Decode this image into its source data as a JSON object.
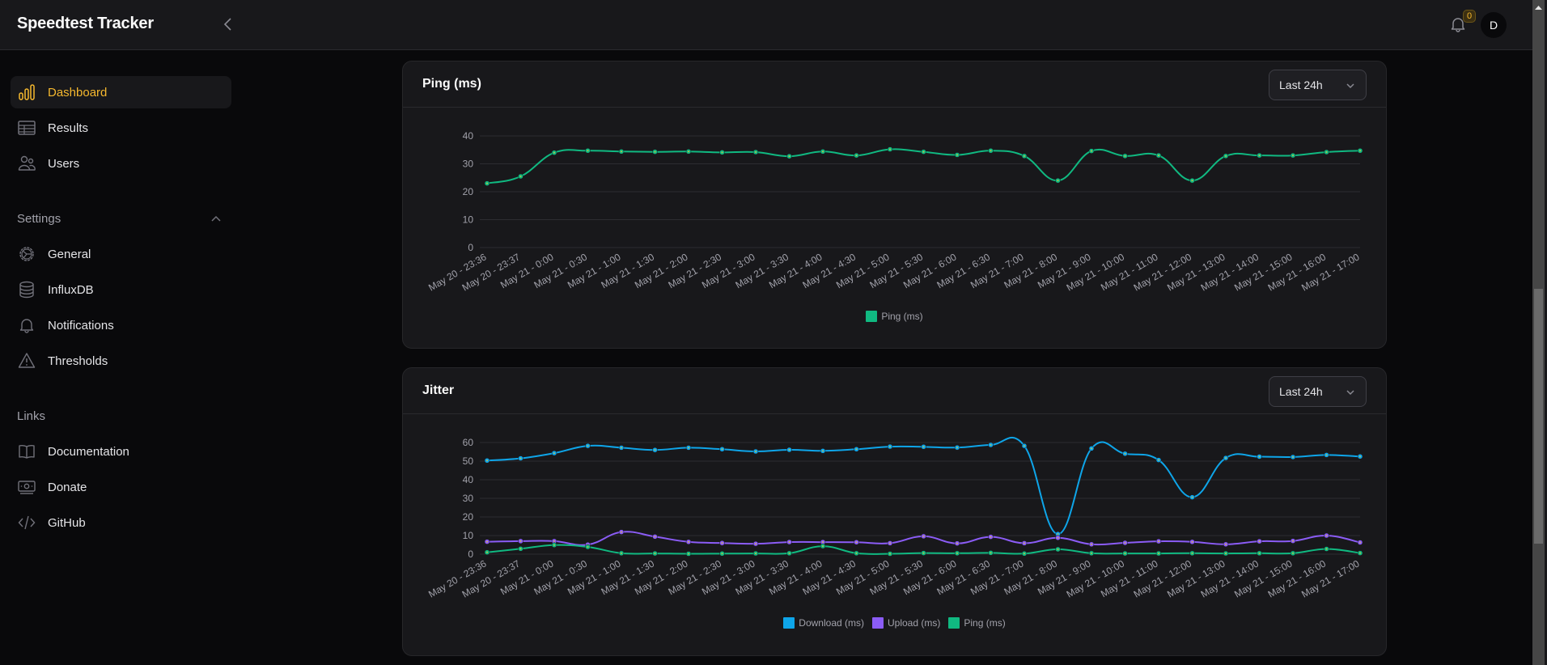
{
  "app": {
    "title": "Speedtest Tracker"
  },
  "topbar": {
    "notification_count": "0",
    "avatar_initial": "D"
  },
  "sidebar": {
    "main_items": [
      {
        "label": "Dashboard",
        "icon": "chart-bar-icon",
        "active": true
      },
      {
        "label": "Results",
        "icon": "table-icon",
        "active": false
      },
      {
        "label": "Users",
        "icon": "users-icon",
        "active": false
      }
    ],
    "settings_label": "Settings",
    "settings_items": [
      {
        "label": "General",
        "icon": "cog-icon"
      },
      {
        "label": "InfluxDB",
        "icon": "database-icon"
      },
      {
        "label": "Notifications",
        "icon": "bell-icon"
      },
      {
        "label": "Thresholds",
        "icon": "warning-icon"
      }
    ],
    "links_label": "Links",
    "links_items": [
      {
        "label": "Documentation",
        "icon": "book-icon"
      },
      {
        "label": "Donate",
        "icon": "banknotes-icon"
      },
      {
        "label": "GitHub",
        "icon": "code-icon"
      }
    ]
  },
  "colors": {
    "accent": "#f5b82e",
    "download": "#0ea5e9",
    "upload": "#8b5cf6",
    "ping": "#10b981"
  },
  "ping_card": {
    "title": "Ping (ms)",
    "range": "Last 24h"
  },
  "jitter_card": {
    "title": "Jitter",
    "range": "Last 24h"
  },
  "chart_data": [
    {
      "type": "line",
      "title": "Ping (ms)",
      "xlabel": "",
      "ylabel": "",
      "ylim": [
        0,
        40
      ],
      "yticks": [
        "0",
        "10",
        "20",
        "30",
        "40"
      ],
      "grid": true,
      "legend": "bottom",
      "categories": [
        "May 20 - 23:36",
        "May 20 - 23:37",
        "May 21 - 0:00",
        "May 21 - 0:30",
        "May 21 - 1:00",
        "May 21 - 1:30",
        "May 21 - 2:00",
        "May 21 - 2:30",
        "May 21 - 3:00",
        "May 21 - 3:30",
        "May 21 - 4:00",
        "May 21 - 4:30",
        "May 21 - 5:00",
        "May 21 - 5:30",
        "May 21 - 6:00",
        "May 21 - 6:30",
        "May 21 - 7:00",
        "May 21 - 8:00",
        "May 21 - 9:00",
        "May 21 - 10:00",
        "May 21 - 11:00",
        "May 21 - 12:00",
        "May 21 - 13:00",
        "May 21 - 14:00",
        "May 21 - 15:00",
        "May 21 - 16:00",
        "May 21 - 17:00"
      ],
      "series": [
        {
          "name": "Ping (ms)",
          "color": "#10b981",
          "values": [
            23,
            25.5,
            34,
            34.7,
            34.4,
            34.3,
            34.4,
            34.1,
            34.2,
            32.7,
            34.4,
            33,
            35.2,
            34.3,
            33.2,
            34.7,
            32.8,
            24,
            34.6,
            32.8,
            33,
            24,
            32.8,
            33,
            33,
            34.2,
            34.7
          ]
        }
      ]
    },
    {
      "type": "line",
      "title": "Jitter",
      "xlabel": "",
      "ylabel": "",
      "ylim": [
        0,
        60
      ],
      "yticks": [
        "0",
        "10",
        "20",
        "30",
        "40",
        "50",
        "60"
      ],
      "grid": true,
      "legend": "bottom",
      "categories": [
        "May 20 - 23:36",
        "May 20 - 23:37",
        "May 21 - 0:00",
        "May 21 - 0:30",
        "May 21 - 1:00",
        "May 21 - 1:30",
        "May 21 - 2:00",
        "May 21 - 2:30",
        "May 21 - 3:00",
        "May 21 - 3:30",
        "May 21 - 4:00",
        "May 21 - 4:30",
        "May 21 - 5:00",
        "May 21 - 5:30",
        "May 21 - 6:00",
        "May 21 - 6:30",
        "May 21 - 7:00",
        "May 21 - 8:00",
        "May 21 - 9:00",
        "May 21 - 10:00",
        "May 21 - 11:00",
        "May 21 - 12:00",
        "May 21 - 13:00",
        "May 21 - 14:00",
        "May 21 - 15:00",
        "May 21 - 16:00",
        "May 21 - 17:00"
      ],
      "series": [
        {
          "name": "Download (ms)",
          "color": "#0ea5e9",
          "values": [
            50.3,
            51.5,
            54.3,
            58.2,
            57.2,
            56,
            57.2,
            56.4,
            55.2,
            56.1,
            55.5,
            56.4,
            57.8,
            57.7,
            57.3,
            58.7,
            58.2,
            10.8,
            56.8,
            54,
            50.6,
            30.6,
            51.7,
            52.4,
            52.2,
            53.3,
            52.5
          ]
        },
        {
          "name": "Upload (ms)",
          "color": "#8b5cf6",
          "values": [
            6.7,
            7,
            7,
            5.1,
            11.9,
            9.4,
            6.6,
            6,
            5.6,
            6.5,
            6.5,
            6.4,
            5.9,
            9.6,
            5.8,
            9.3,
            5.9,
            8.8,
            5.3,
            6.1,
            6.9,
            6.6,
            5.3,
            6.9,
            7.1,
            10,
            6.3
          ]
        },
        {
          "name": "Ping (ms)",
          "color": "#10b981",
          "values": [
            1,
            2.9,
            4.9,
            3.9,
            0.5,
            0.4,
            0.2,
            0.3,
            0.4,
            0.5,
            4.3,
            0.5,
            0.2,
            0.6,
            0.5,
            0.7,
            0.3,
            2.6,
            0.5,
            0.4,
            0.4,
            0.5,
            0.4,
            0.5,
            0.5,
            2.8,
            0.6
          ]
        }
      ]
    }
  ]
}
